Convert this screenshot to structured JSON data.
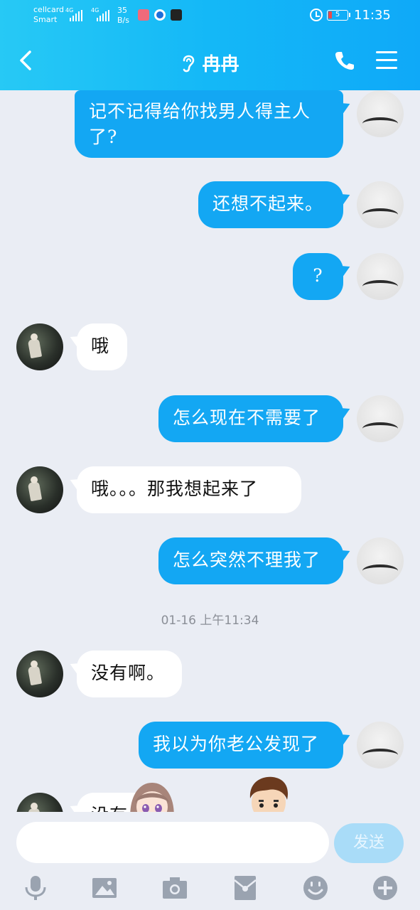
{
  "status_bar": {
    "carrier_line1": "cellcard",
    "carrier_line2": "Smart",
    "net1": "4G",
    "net2": "4G",
    "speed_value": "35",
    "speed_unit": "B/s",
    "battery": "5",
    "time": "11:35"
  },
  "header": {
    "title": "冉冉",
    "colors": {
      "gradient_start": "#27c9f5",
      "gradient_end": "#0fa9f8"
    }
  },
  "messages": [
    {
      "side": "out",
      "text_line1": "记不记得给你找男人得主人",
      "text_line2": "了?"
    },
    {
      "side": "out",
      "text": "还想不起来。"
    },
    {
      "side": "out",
      "text": "?"
    },
    {
      "side": "in",
      "text": "哦"
    },
    {
      "side": "out",
      "text": "怎么现在不需要了"
    },
    {
      "side": "in",
      "text": "哦。。。那我想起来了"
    },
    {
      "side": "out",
      "text": "怎么突然不理我了"
    },
    {
      "side": "out",
      "text": "我以为你老公发现了"
    },
    {
      "side": "in",
      "text": "没有啊。"
    },
    {
      "side": "in",
      "text": "没有"
    }
  ],
  "timestamp": "01-16 上午11:34",
  "input": {
    "placeholder": "",
    "send_label": "发送"
  },
  "toolbar_icons": [
    "microphone-icon",
    "image-icon",
    "camera-icon",
    "red-packet-icon",
    "emoji-icon",
    "plus-icon"
  ],
  "colors": {
    "bubble_out": "#13a7f3",
    "bubble_in": "#ffffff",
    "background": "#eaedf4"
  }
}
